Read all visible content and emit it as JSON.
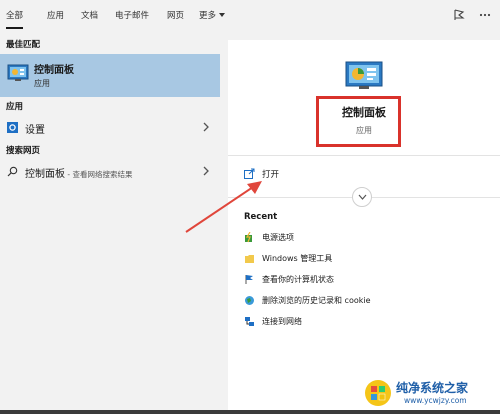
{
  "tabs": [
    {
      "label": "全部",
      "active": true
    },
    {
      "label": "应用",
      "active": false
    },
    {
      "label": "文档",
      "active": false
    },
    {
      "label": "电子邮件",
      "active": false
    },
    {
      "label": "网页",
      "active": false
    },
    {
      "label": "更多",
      "active": false
    }
  ],
  "left": {
    "best_match_heading": "最佳匹配",
    "best_match": {
      "title": "控制面板",
      "subtitle": "应用"
    },
    "apps_heading": "应用",
    "settings_label": "设置",
    "web_heading": "搜索网页",
    "web_result": {
      "label": "控制面板",
      "hint": " - 查看网络搜索结果"
    }
  },
  "right": {
    "app_title": "控制面板",
    "app_subtitle": "应用",
    "open_label": "打开",
    "recent_heading": "Recent",
    "recent_items": [
      {
        "icon": "power-options-icon",
        "label": "电源选项"
      },
      {
        "icon": "folder-icon",
        "label": "Windows 管理工具"
      },
      {
        "icon": "flag-icon",
        "label": "查看你的计算机状态"
      },
      {
        "icon": "globe-icon",
        "label": "删除浏览的历史记录和 cookie"
      },
      {
        "icon": "network-icon",
        "label": "连接到网络"
      }
    ]
  },
  "watermark": {
    "title": "纯净系统之家",
    "url": "www.ycwjzy.com"
  },
  "colors": {
    "selected_bg": "#a8c8e3",
    "highlight_box": "#d9322b",
    "arrow": "#e0463b",
    "watermark": "#1f5fa8"
  }
}
